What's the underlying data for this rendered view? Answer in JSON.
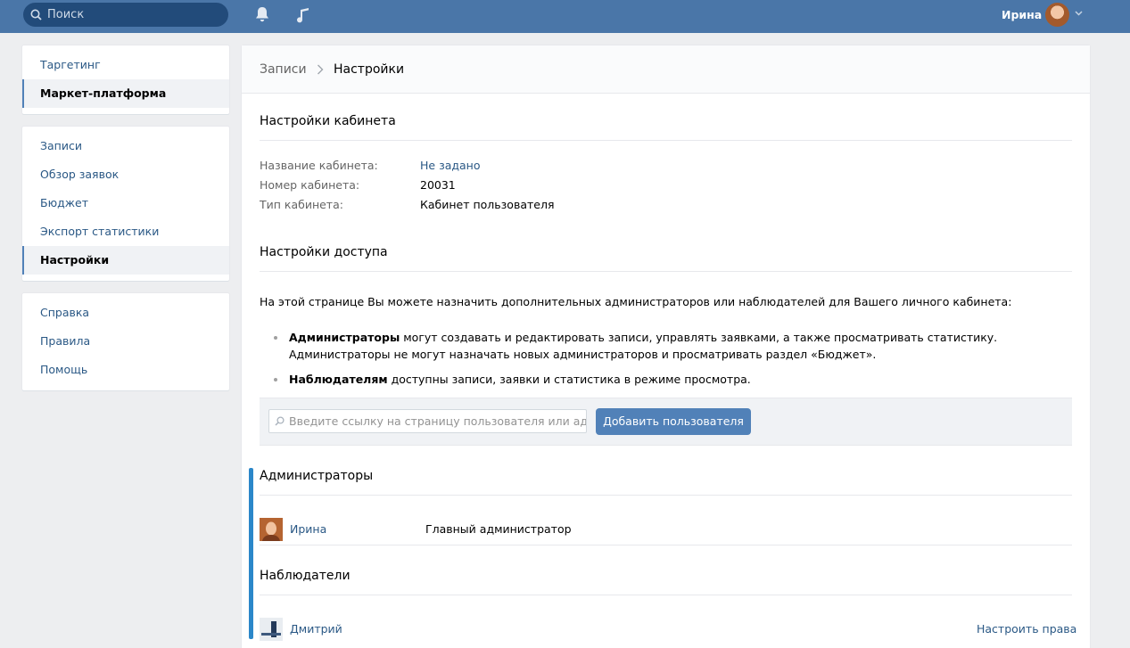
{
  "topbar": {
    "search_placeholder": "Поиск",
    "user_name": "Ирина",
    "icons": [
      "search-icon",
      "bell-icon",
      "music-icon",
      "chevron-down-icon"
    ]
  },
  "sidebar": {
    "group1": [
      {
        "label": "Таргетинг",
        "active": false
      },
      {
        "label": "Маркет-платформа",
        "active": true
      }
    ],
    "group2": [
      {
        "label": "Записи",
        "active": false
      },
      {
        "label": "Обзор заявок",
        "active": false
      },
      {
        "label": "Бюджет",
        "active": false
      },
      {
        "label": "Экспорт статистики",
        "active": false
      },
      {
        "label": "Настройки",
        "active": true
      }
    ],
    "group3": [
      {
        "label": "Справка"
      },
      {
        "label": "Правила"
      },
      {
        "label": "Помощь"
      }
    ]
  },
  "breadcrumb": {
    "parent": "Записи",
    "current": "Настройки"
  },
  "cabinet": {
    "title": "Настройки кабинета",
    "fields": [
      {
        "label": "Название кабинета:",
        "value": "Не задано",
        "is_link": true
      },
      {
        "label": "Номер кабинета:",
        "value": "20031",
        "is_link": false
      },
      {
        "label": "Тип кабинета:",
        "value": "Кабинет пользователя",
        "is_link": false
      }
    ]
  },
  "access": {
    "title": "Настройки доступа",
    "intro": "На этой странице Вы можете назначить дополнительных администраторов или наблюдателей для Вашего личного кабинета:",
    "bullet1_bold": "Администраторы",
    "bullet1_line1": " могут создавать и редактировать записи, управлять заявками, а также просматривать статистику.",
    "bullet1_line2": "Администраторы не могут назначать новых администраторов и просматривать раздел «Бюджет».",
    "bullet2_bold": "Наблюдателям",
    "bullet2_text": " доступны записи, заявки и статистика в режиме просмотра.",
    "input_placeholder": "Введите ссылку на страницу пользователя или адре...",
    "add_button": "Добавить пользователя"
  },
  "admins": {
    "title": "Администраторы",
    "items": [
      {
        "name": "Ирина",
        "role": "Главный администратор"
      }
    ]
  },
  "observers": {
    "title": "Наблюдатели",
    "items": [
      {
        "name": "Дмитрий",
        "action": "Настроить права"
      }
    ]
  },
  "colors": {
    "header_bg": "#4a76a8",
    "link": "#2a5885",
    "button": "#5181b8",
    "accent_line": "#2b87c9"
  }
}
